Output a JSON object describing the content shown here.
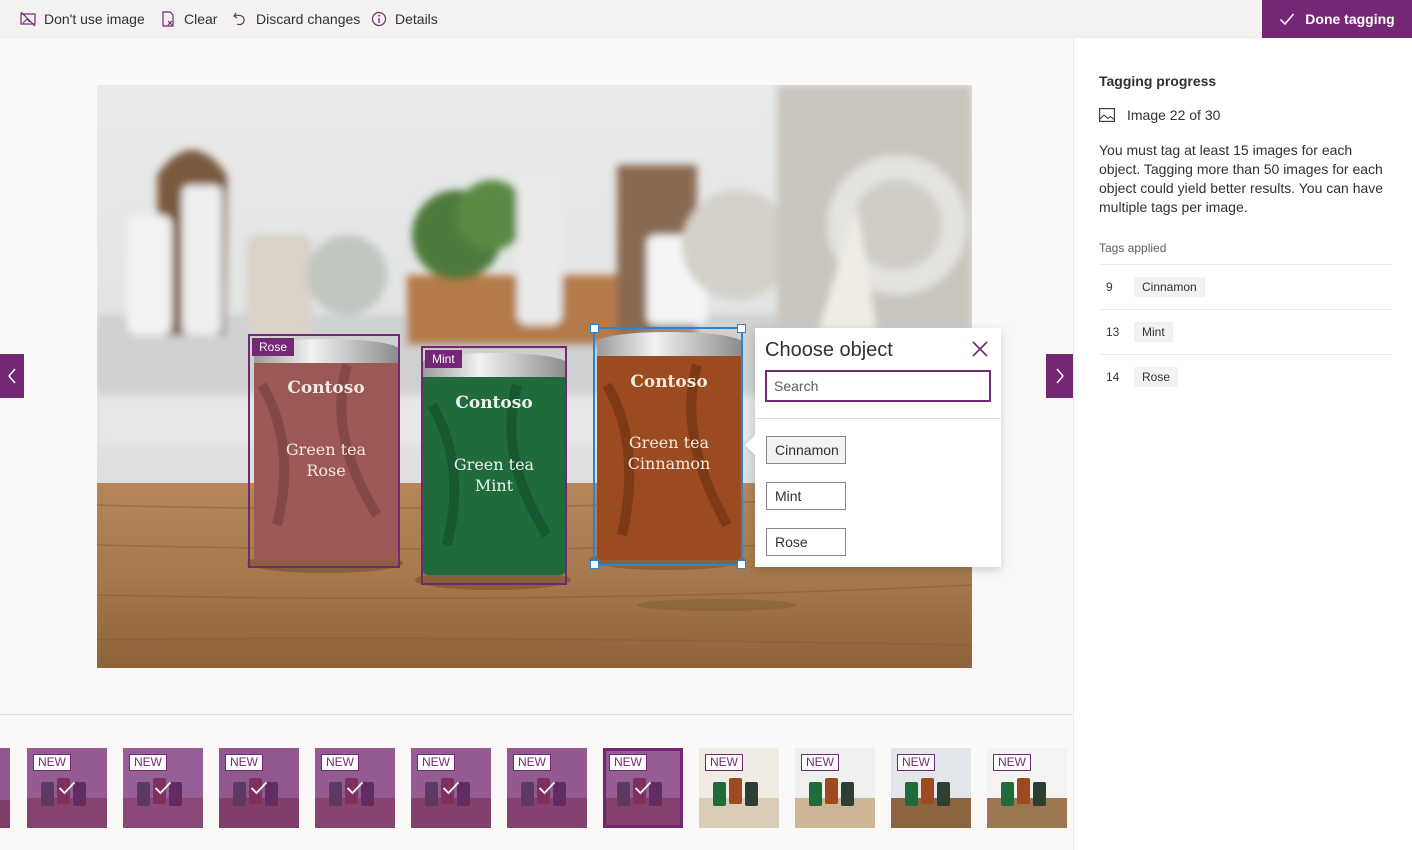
{
  "toolbar": {
    "dont_use_label": "Don't use image",
    "clear_label": "Clear",
    "discard_label": "Discard changes",
    "details_label": "Details",
    "done_label": "Done tagging"
  },
  "image": {
    "boxes": [
      {
        "tag": "Rose"
      },
      {
        "tag": "Mint"
      }
    ]
  },
  "popup": {
    "title": "Choose object",
    "search_placeholder": "Search",
    "options": [
      "Cinnamon",
      "Mint",
      "Rose"
    ]
  },
  "side": {
    "title": "Tagging progress",
    "image_count": "Image 22 of 30",
    "description": "You must tag at least 15 images for each object. Tagging more than 50 images for each object could yield better results. You can have multiple tags per image.",
    "tags_label": "Tags applied",
    "tags": [
      {
        "count": "9",
        "name": "Cinnamon"
      },
      {
        "count": "13",
        "name": "Mint"
      },
      {
        "count": "14",
        "name": "Rose"
      }
    ]
  },
  "filmstrip": {
    "new_label": "NEW",
    "thumbs": [
      {
        "tagged": true
      },
      {
        "tagged": true
      },
      {
        "tagged": true
      },
      {
        "tagged": true
      },
      {
        "tagged": true
      },
      {
        "tagged": true
      },
      {
        "tagged": true,
        "current": true
      },
      {
        "tagged": false
      },
      {
        "tagged": false
      },
      {
        "tagged": false
      },
      {
        "tagged": false
      }
    ]
  },
  "colors": {
    "accent": "#742774",
    "selection": "#2a85d6"
  }
}
